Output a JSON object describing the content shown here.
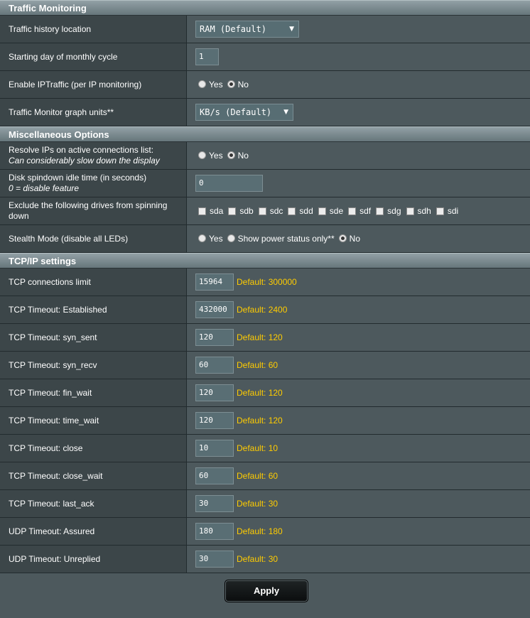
{
  "traffic": {
    "header": "Traffic Monitoring",
    "history_label": "Traffic history location",
    "history_value": "RAM (Default)",
    "start_day_label": "Starting day of monthly cycle",
    "start_day_value": "1",
    "iptraffic_label": "Enable IPTraffic (per IP monitoring)",
    "iptraffic_yes": "Yes",
    "iptraffic_no": "No",
    "graph_units_label": "Traffic Monitor graph units**",
    "graph_units_value": "KB/s (Default)"
  },
  "misc": {
    "header": "Miscellaneous Options",
    "resolve_label": "Resolve IPs on active connections list:",
    "resolve_sub": "Can considerably slow down the display",
    "resolve_yes": "Yes",
    "resolve_no": "No",
    "spindown_label": "Disk spindown idle time (in seconds)",
    "spindown_sub": "0 = disable feature",
    "spindown_value": "0",
    "exclude_label_1": "Exclude the following drives from spinning",
    "exclude_label_2": "down",
    "drives": [
      "sda",
      "sdb",
      "sdc",
      "sdd",
      "sde",
      "sdf",
      "sdg",
      "sdh",
      "sdi"
    ],
    "stealth_label": "Stealth Mode (disable all LEDs)",
    "stealth_yes": "Yes",
    "stealth_power": "Show power status only**",
    "stealth_no": "No"
  },
  "tcpip": {
    "header": "TCP/IP settings",
    "rows": [
      {
        "label": "TCP connections limit",
        "value": "15964",
        "default": "Default: 300000"
      },
      {
        "label": "TCP Timeout: Established",
        "value": "432000",
        "default": "Default: 2400"
      },
      {
        "label": "TCP Timeout: syn_sent",
        "value": "120",
        "default": "Default: 120"
      },
      {
        "label": "TCP Timeout: syn_recv",
        "value": "60",
        "default": "Default: 60"
      },
      {
        "label": "TCP Timeout: fin_wait",
        "value": "120",
        "default": "Default: 120"
      },
      {
        "label": "TCP Timeout: time_wait",
        "value": "120",
        "default": "Default: 120"
      },
      {
        "label": "TCP Timeout: close",
        "value": "10",
        "default": "Default: 10"
      },
      {
        "label": "TCP Timeout: close_wait",
        "value": "60",
        "default": "Default: 60"
      },
      {
        "label": "TCP Timeout: last_ack",
        "value": "30",
        "default": "Default: 30"
      },
      {
        "label": "UDP Timeout: Assured",
        "value": "180",
        "default": "Default: 180"
      },
      {
        "label": "UDP Timeout: Unreplied",
        "value": "30",
        "default": "Default: 30"
      }
    ]
  },
  "apply_label": "Apply"
}
